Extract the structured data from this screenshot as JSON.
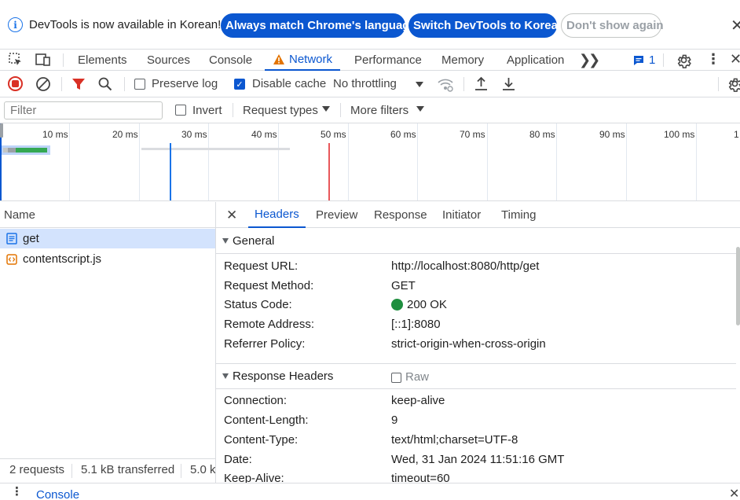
{
  "infobar": {
    "message": "DevTools is now available in Korean!",
    "match_button": "Always match Chrome's language",
    "switch_button": "Switch DevTools to Korean",
    "dismiss_button": "Don't show again"
  },
  "tabs": {
    "items": [
      "Elements",
      "Sources",
      "Console",
      "Network",
      "Performance",
      "Memory",
      "Application"
    ],
    "active": "Network",
    "issues_count": "1"
  },
  "toolbar": {
    "preserve_log": "Preserve log",
    "disable_cache": "Disable cache",
    "throttling": "No throttling",
    "preserve_log_checked": false,
    "disable_cache_checked": true
  },
  "filterbar": {
    "filter_placeholder": "Filter",
    "invert": "Invert",
    "request_types": "Request types",
    "more_filters": "More filters"
  },
  "timeline": {
    "ticks": [
      "10 ms",
      "20 ms",
      "30 ms",
      "40 ms",
      "50 ms",
      "60 ms",
      "70 ms",
      "80 ms",
      "90 ms",
      "100 ms",
      "1"
    ]
  },
  "requests": {
    "header": "Name",
    "items": [
      {
        "name": "get",
        "type": "document"
      },
      {
        "name": "contentscript.js",
        "type": "script"
      }
    ]
  },
  "status": {
    "requests": "2 requests",
    "transferred": "5.1 kB transferred",
    "resources": "5.0 k"
  },
  "details": {
    "tabs": [
      "Headers",
      "Preview",
      "Response",
      "Initiator",
      "Timing"
    ],
    "active_tab": "Headers",
    "general": {
      "title": "General",
      "rows": [
        {
          "key": "Request URL:",
          "value": "http://localhost:8080/http/get"
        },
        {
          "key": "Request Method:",
          "value": "GET"
        },
        {
          "key": "Status Code:",
          "value": "200 OK"
        },
        {
          "key": "Remote Address:",
          "value": "[::1]:8080"
        },
        {
          "key": "Referrer Policy:",
          "value": "strict-origin-when-cross-origin"
        }
      ]
    },
    "response_headers": {
      "title": "Response Headers",
      "raw_label": "Raw",
      "rows": [
        {
          "key": "Connection:",
          "value": "keep-alive"
        },
        {
          "key": "Content-Length:",
          "value": "9"
        },
        {
          "key": "Content-Type:",
          "value": "text/html;charset=UTF-8"
        },
        {
          "key": "Date:",
          "value": "Wed, 31 Jan 2024 11:51:16 GMT"
        },
        {
          "key": "Keep-Alive:",
          "value": "timeout=60"
        }
      ]
    }
  },
  "drawer": {
    "tab": "Console"
  },
  "colors": {
    "accent": "#0b57d0",
    "record_red": "#d93025",
    "status_green": "#1e8e3e",
    "warning_orange": "#e37400"
  }
}
